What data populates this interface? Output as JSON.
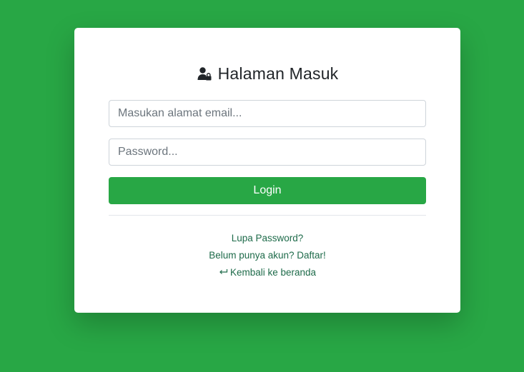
{
  "page": {
    "background_color": "#28a745",
    "title": "Halaman Masuk",
    "title_icon": "user-lock-icon"
  },
  "form": {
    "email_placeholder": "Masukan alamat email...",
    "email_value": "",
    "password_placeholder": "Password...",
    "password_value": "",
    "login_label": "Login",
    "accent_color": "#28a745"
  },
  "links": {
    "forgot_password": "Lupa Password?",
    "register": "Belum punya akun? Daftar!",
    "back_icon": "return-arrow-icon",
    "back_home": "Kembali ke beranda",
    "link_color": "#1e6b4a"
  }
}
